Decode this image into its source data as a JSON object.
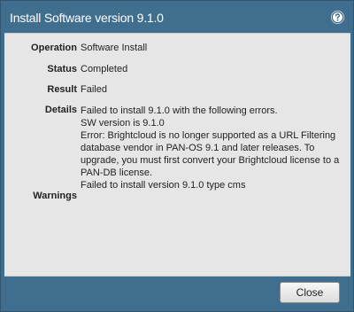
{
  "dialog": {
    "title": "Install Software version 9.1.0",
    "help_icon": "help-circle-icon"
  },
  "fields": {
    "operation": {
      "label": "Operation",
      "value": "Software Install"
    },
    "status": {
      "label": "Status",
      "value": "Completed"
    },
    "result": {
      "label": "Result",
      "value": "Failed"
    },
    "details": {
      "label": "Details",
      "lines": [
        "Failed to install 9.1.0 with the following errors.",
        "SW version is 9.1.0",
        "Error: Brightcloud is no longer supported as a URL Filtering",
        "database vendor in PAN-OS 9.1 and later releases. To",
        "upgrade, you must first convert your Brightcloud license to a",
        "PAN-DB license.",
        "Failed to install version 9.1.0 type cms"
      ]
    },
    "warnings": {
      "label": "Warnings",
      "value": ""
    }
  },
  "footer": {
    "close_label": "Close"
  },
  "colors": {
    "frame": "#406e8e",
    "content_bg": "#e6e6e6",
    "text": "#222222"
  }
}
